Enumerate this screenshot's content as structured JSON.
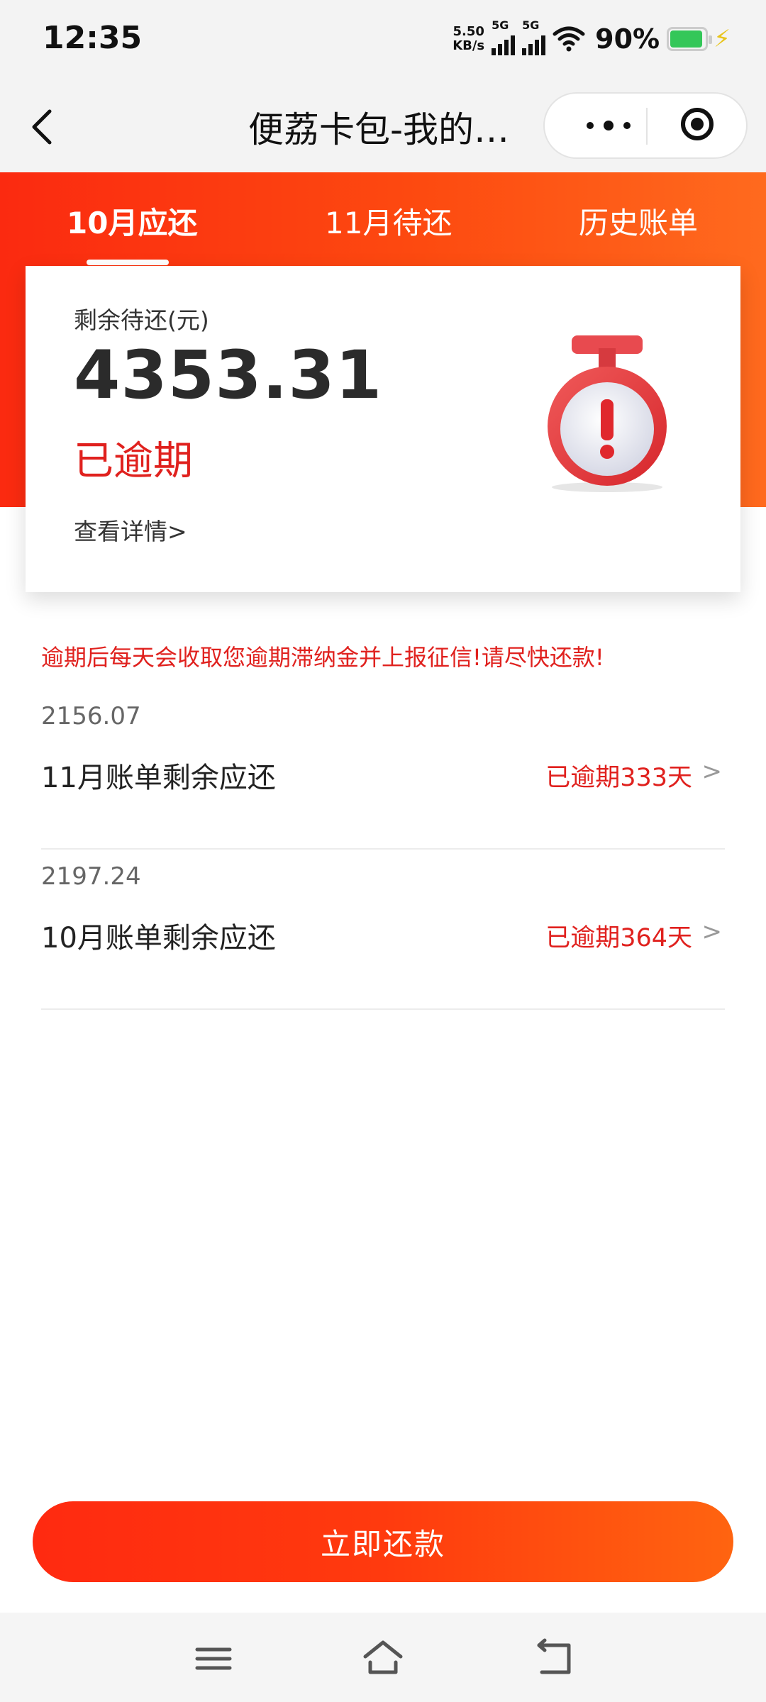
{
  "status_bar": {
    "time": "12:35",
    "net_speed_value": "5.50",
    "net_speed_unit": "KB/s",
    "signal1_label": "5G",
    "signal2_label": "5G",
    "battery_percent": "90%",
    "battery_level": 0.9,
    "icons": [
      "wifi-icon",
      "signal-icon",
      "battery-icon",
      "charging-icon"
    ]
  },
  "nav": {
    "title": "便荔卡包-我的…",
    "back_icon": "chevron-left-icon",
    "more_icon": "more-dots-icon",
    "close_icon": "target-circle-icon"
  },
  "tabs": [
    {
      "label": "10月应还",
      "active": true
    },
    {
      "label": "11月待还",
      "active": false
    },
    {
      "label": "历史账单",
      "active": false
    }
  ],
  "summary": {
    "label": "剩余待还(元)",
    "amount": "4353.31",
    "status": "已逾期",
    "details_link": "查看详情>",
    "illustration": "alarm-clock-exclamation-icon"
  },
  "notice": "逾期后每天会收取您逾期滞纳金并上报征信!请尽快还款!",
  "bills": [
    {
      "amount": "2156.07",
      "name": "11月账单剩余应还",
      "overdue": "已逾期333天",
      "chevron": ">"
    },
    {
      "amount": "2197.24",
      "name": "10月账单剩余应还",
      "overdue": "已逾期364天",
      "chevron": ">"
    }
  ],
  "pay_button": "立即还款",
  "colors": {
    "brand_red": "#fb2a10",
    "brand_orange": "#ff6a1e",
    "overdue_red": "#e0211e"
  },
  "system_nav": [
    "menu-icon",
    "home-icon",
    "back-icon"
  ]
}
